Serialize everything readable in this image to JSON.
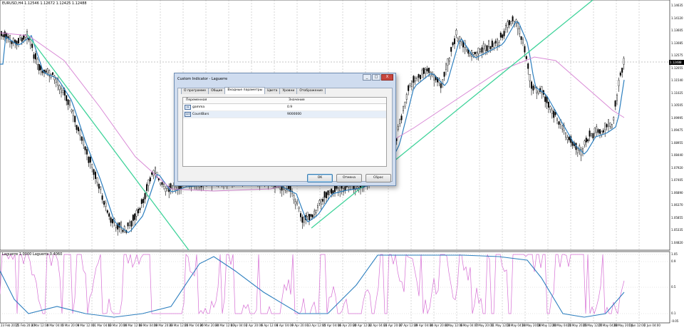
{
  "chart": {
    "symbol": "EURUSD,H4  1.12546  1.12672  1.12425  1.12488",
    "current_price": "1.12488",
    "price_labels": [
      "1.14635",
      "1.14120",
      "1.13605",
      "1.13085",
      "1.12575",
      "1.12055",
      "1.11540",
      "1.11025",
      "1.10505",
      "1.09995",
      "1.09475",
      "1.08955",
      "1.08440",
      "1.07920",
      "1.07405",
      "1.06890",
      "1.06370",
      "1.05855",
      "1.05335",
      "1.04820"
    ],
    "time_labels": [
      "23 Feb 2015",
      "25 Feb 20:00",
      "2 Mar 12:00",
      "4 Mar 04:00",
      "5 Mar 20:00",
      "9 Mar 12:00",
      "11 Mar 04:00",
      "12 Mar 20:00",
      "16 Mar 12:00",
      "18 Mar 04:00",
      "19 Mar 20:00",
      "23 Mar 12:00",
      "25 Mar 04:00",
      "26 Mar 20:00",
      "30 Mar 12:00",
      "1 Apr 04:00",
      "2 Apr 20:00",
      "6 Apr 12:00",
      "8 Apr 04:00",
      "9 Apr 20:00",
      "13 Apr 12:00",
      "15 Apr 04:00",
      "16 Apr 20:00",
      "20 Apr 12:00",
      "22 Apr 04:00",
      "23 Apr 20:00",
      "27 Apr 12:00",
      "29 Apr 04:00",
      "30 Apr 20:00",
      "4 May 12:00",
      "6 May 04:00",
      "7 May 20:00",
      "11 May 12:00",
      "13 May 04:00",
      "14 May 20:00",
      "18 May 12:00",
      "20 May 04:00",
      "21 May 20:00",
      "25 May 12:00",
      "27 May 04:00",
      "28 May 20:00",
      "1 Jun 12:00",
      "2 Jun 04:00"
    ],
    "indicator_label": "Laguerre 1.0000  Laguerre 0.4060",
    "indicator_levels": [
      "1.05",
      "0.9",
      "0.5",
      "0.1",
      "-0.05"
    ],
    "colors": {
      "trend": "#3fd39a",
      "fast_ma": "#2d7fbf",
      "slow_ma": "#d98ad6",
      "candles": "#000000",
      "osc_blue": "#2d7fbf",
      "osc_pink": "#d66ed4"
    }
  },
  "dialog": {
    "title": "Custom Indicator - Laguerre",
    "buttons_window": {
      "minimize": "_",
      "maximize": "□",
      "close": "X"
    },
    "tabs": [
      "О программе",
      "Общие",
      "Входные параметры",
      "Цвета",
      "Уровни",
      "Отображение"
    ],
    "active_tab": "Входные параметры",
    "columns": {
      "name": "Переменная",
      "value": "Значение"
    },
    "params": [
      {
        "icon": "Va",
        "name": "gamma",
        "value": "0.9"
      },
      {
        "icon": "123",
        "name": "CountBars",
        "value": "9000000"
      }
    ],
    "ok_label": "OK",
    "cancel_label": "Отмена",
    "reset_label": "Сброс"
  }
}
